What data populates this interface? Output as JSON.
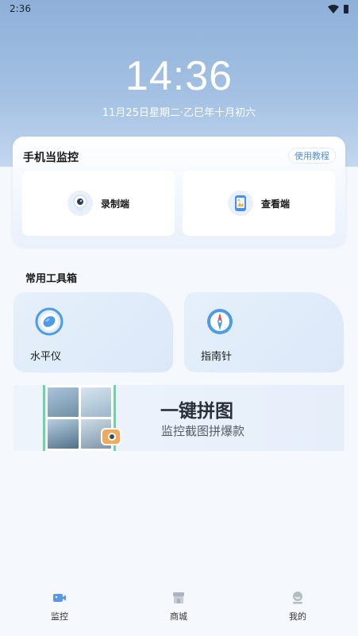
{
  "status_bar": {
    "time": "2:36"
  },
  "header": {
    "clock": "14:36",
    "date": "11月25日星期二·乙巳年十月初六"
  },
  "monitor": {
    "title": "手机当监控",
    "tutorial_label": "使用教程",
    "record_label": "录制端",
    "view_label": "查看端"
  },
  "toolbox": {
    "title": "常用工具箱",
    "tools": [
      {
        "label": "水平仪"
      },
      {
        "label": "指南针"
      }
    ]
  },
  "banner": {
    "title": "一键拼图",
    "subtitle": "监控截图拼爆款"
  },
  "tabs": [
    {
      "label": "监控"
    },
    {
      "label": "商城"
    },
    {
      "label": "我的"
    }
  ],
  "colors": {
    "accent": "#4b8ee6",
    "header_bg": "#8eb0d8"
  }
}
